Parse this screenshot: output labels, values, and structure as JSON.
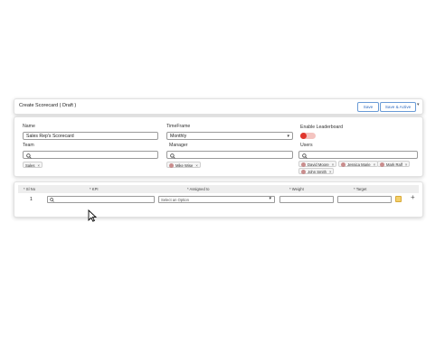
{
  "header": {
    "title": "Create Scorecard ( Draft )",
    "save_label": "Save",
    "save_active_label": "Save & Active",
    "caret": "▾"
  },
  "form": {
    "name_label": "Name",
    "name_value": "Sales Rep's Scorecard",
    "timeframe_label": "TimeFrame",
    "timeframe_value": "Monthly",
    "leaderboard_label": "Enable Leaderboard",
    "leaderboard_enabled": false,
    "team_label": "Team",
    "team_chips": [
      "Sales"
    ],
    "manager_label": "Manager",
    "manager_chips": [
      "Mike Wise"
    ],
    "users_label": "Users",
    "users_chips": [
      "David Moore",
      "Jessica Marie",
      "Mark Ralf",
      "John Smith"
    ]
  },
  "table": {
    "headers": [
      "* Sl No",
      "* KPI",
      "* Assigned to",
      "* Weight",
      "* Target"
    ],
    "rows": [
      {
        "sl_no": "1",
        "assigned_placeholder": "Select an Option"
      }
    ],
    "add_symbol": "+"
  },
  "colors": {
    "accent": "#2f6bc0",
    "toggle_off": "#e0362d",
    "row_icon": "#f4d06a"
  },
  "icons": [
    "search-icon",
    "chevron-down-icon",
    "close-icon",
    "plus-icon",
    "cursor-icon",
    "edit-icon"
  ]
}
